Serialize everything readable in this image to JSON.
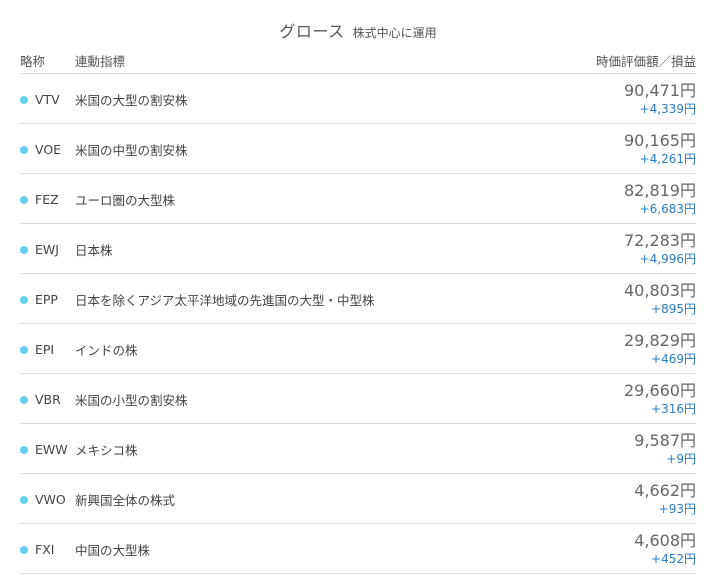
{
  "title": {
    "main": "グロース",
    "sub": "株式中心に運用"
  },
  "columns": {
    "ticker": "略称",
    "index": "連動指標",
    "value": "時価評価額／損益"
  },
  "accent_color": "#66d1f0",
  "gain_color": "#2a7dc4",
  "rows": [
    {
      "ticker": "VTV",
      "index": "米国の大型の割安株",
      "valuation": "90,471円",
      "pl": "+4,339円"
    },
    {
      "ticker": "VOE",
      "index": "米国の中型の割安株",
      "valuation": "90,165円",
      "pl": "+4,261円"
    },
    {
      "ticker": "FEZ",
      "index": "ユーロ圏の大型株",
      "valuation": "82,819円",
      "pl": "+6,683円"
    },
    {
      "ticker": "EWJ",
      "index": "日本株",
      "valuation": "72,283円",
      "pl": "+4,996円"
    },
    {
      "ticker": "EPP",
      "index": "日本を除くアジア太平洋地域の先進国の大型・中型株",
      "valuation": "40,803円",
      "pl": "+895円"
    },
    {
      "ticker": "EPI",
      "index": "インドの株",
      "valuation": "29,829円",
      "pl": "+469円"
    },
    {
      "ticker": "VBR",
      "index": "米国の小型の割安株",
      "valuation": "29,660円",
      "pl": "+316円"
    },
    {
      "ticker": "EWW",
      "index": "メキシコ株",
      "valuation": "9,587円",
      "pl": "+9円"
    },
    {
      "ticker": "VWO",
      "index": "新興国全体の株式",
      "valuation": "4,662円",
      "pl": "+93円"
    },
    {
      "ticker": "FXI",
      "index": "中国の大型株",
      "valuation": "4,608円",
      "pl": "+452円"
    }
  ]
}
